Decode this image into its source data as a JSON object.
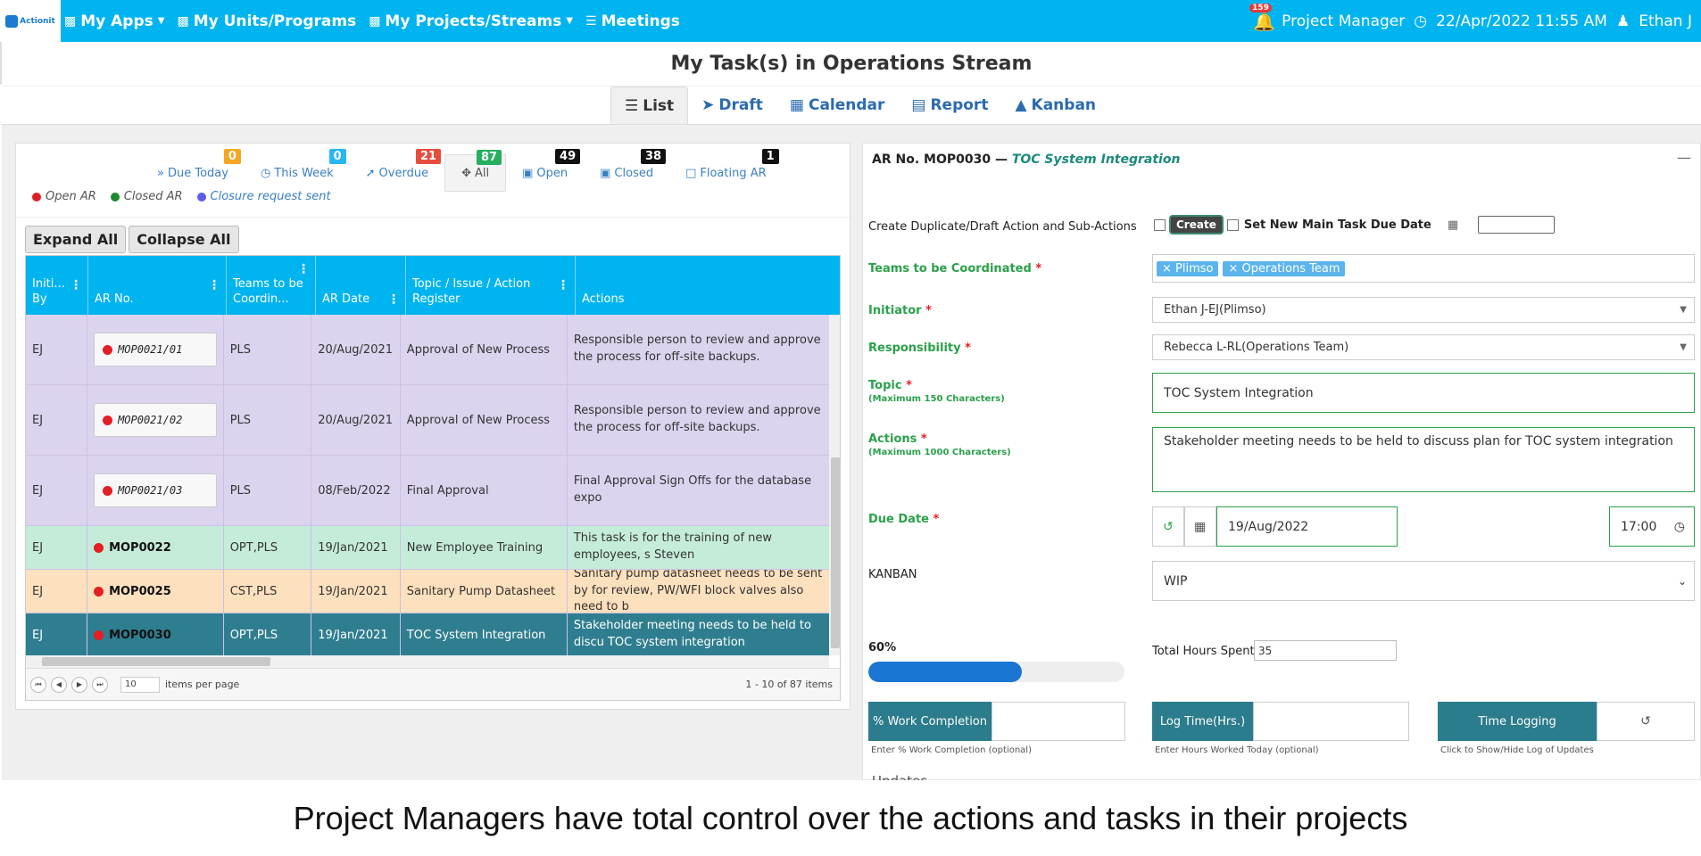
{
  "nav": {
    "logo_text": "Actionit",
    "items": [
      {
        "label": "My Apps",
        "icon": "briefcase-icon",
        "dropdown": true
      },
      {
        "label": "My Units/Programs",
        "icon": "briefcase-icon",
        "dropdown": false
      },
      {
        "label": "My Projects/Streams",
        "icon": "briefcase-icon",
        "dropdown": true
      },
      {
        "label": "Meetings",
        "icon": "list-icon",
        "dropdown": false
      }
    ],
    "notification_count": "159",
    "role": "Project Manager",
    "datetime": "22/Apr/2022 11:55 AM",
    "user": "Ethan J"
  },
  "page_title": "My Task(s) in Operations Stream",
  "view_tabs": [
    {
      "label": "List",
      "icon": "list-icon",
      "active": true
    },
    {
      "label": "Draft",
      "icon": "paper-plane-icon",
      "active": false
    },
    {
      "label": "Calendar",
      "icon": "calendar-icon",
      "active": false
    },
    {
      "label": "Report",
      "icon": "book-icon",
      "active": false
    },
    {
      "label": "Kanban",
      "icon": "area-chart-icon",
      "active": false
    }
  ],
  "filters": [
    {
      "label": "Due Today",
      "icon": "chevrons-down-icon",
      "count": "0",
      "color": "#f5a623"
    },
    {
      "label": "This Week",
      "icon": "clock-icon",
      "count": "0",
      "color": "#29b6f6"
    },
    {
      "label": "Overdue",
      "icon": "arrow-circle-icon",
      "count": "21",
      "color": "#e74c3c"
    },
    {
      "label": "All",
      "icon": "move-icon",
      "count": "87",
      "color": "#27ae60",
      "active": true
    },
    {
      "label": "Open",
      "icon": "unlock-icon",
      "count": "49",
      "color": "#111111"
    },
    {
      "label": "Closed",
      "icon": "lock-icon",
      "count": "38",
      "color": "#111111"
    },
    {
      "label": "Floating AR",
      "icon": "file-icon",
      "count": "1",
      "color": "#111111"
    }
  ],
  "legend": [
    {
      "label": "Open AR",
      "color": "#e31e24"
    },
    {
      "label": "Closed AR",
      "color": "#1e8a2e"
    },
    {
      "label": "Closure request sent",
      "color": "#5b5bf0",
      "link": true
    }
  ],
  "buttons": {
    "expand_all": "Expand All",
    "collapse_all": "Collapse All"
  },
  "grid": {
    "columns": [
      "Initi... By",
      "AR No.",
      "Teams to be Coordin...",
      "AR Date",
      "Topic / Issue / Action Register",
      "Actions"
    ],
    "rows": [
      {
        "initiated_by": "EJ",
        "ar_no": "MOP0021/01",
        "teams": "PLS",
        "ar_date": "20/Aug/2021",
        "topic": "Approval of New Process",
        "actions": "Responsible person to review and approve the process for off-site backups.",
        "bg": "#dcd3ee",
        "boxed": true
      },
      {
        "initiated_by": "EJ",
        "ar_no": "MOP0021/02",
        "teams": "PLS",
        "ar_date": "20/Aug/2021",
        "topic": "Approval of New Process",
        "actions": "Responsible person to review and approve the process for off-site backups.",
        "bg": "#dcd3ee",
        "boxed": true
      },
      {
        "initiated_by": "EJ",
        "ar_no": "MOP0021/03",
        "teams": "PLS",
        "ar_date": "08/Feb/2022",
        "topic": "Final Approval",
        "actions": "Final Approval Sign Offs for the database expo",
        "bg": "#dcd3ee",
        "boxed": true
      },
      {
        "initiated_by": "EJ",
        "ar_no": "MOP0022",
        "teams": "OPT,PLS",
        "ar_date": "19/Jan/2021",
        "topic": "New Employee Training",
        "actions": "This task is for the training of new employees, s Steven",
        "bg": "#c5ecd9",
        "boxed": false
      },
      {
        "initiated_by": "EJ",
        "ar_no": "MOP0025",
        "teams": "CST,PLS",
        "ar_date": "19/Jan/2021",
        "topic": "Sanitary Pump Datasheet",
        "actions": "Sanitary pump datasheet needs to be sent by for review, PW/WFI block valves also need to b",
        "bg": "#fde0bd",
        "boxed": false
      },
      {
        "initiated_by": "EJ",
        "ar_no": "MOP0030",
        "teams": "OPT,PLS",
        "ar_date": "19/Jan/2021",
        "topic": "TOC System Integration",
        "actions": "Stakeholder meeting needs to be held to discu TOC system integration",
        "bg": "#2f7e90",
        "boxed": false,
        "selected": true
      }
    ],
    "page_size": "10",
    "items_per_page_label": "items per page",
    "range_info": "1 - 10 of 87 items"
  },
  "detail": {
    "ar_label": "AR No. MOP0030 —",
    "ar_topic": "TOC System Integration",
    "duplicate_label": "Create Duplicate/Draft Action and Sub-Actions",
    "create_button": "Create",
    "new_due_label": "Set New Main Task Due Date",
    "teams_label": "Teams to be Coordinated",
    "teams": [
      "Plimso",
      "Operations Team"
    ],
    "initiator_label": "Initiator",
    "initiator_value": "Ethan J-EJ(Plimso)",
    "responsibility_label": "Responsibility",
    "responsibility_value": "Rebecca L-RL(Operations Team)",
    "topic_label": "Topic",
    "topic_hint": "(Maximum 150 Characters)",
    "topic_value": "TOC System Integration",
    "actions_label": "Actions",
    "actions_hint": "(Maximum 1000 Characters)",
    "actions_value": "Stakeholder meeting needs to be held to discuss plan for TOC system integration",
    "due_label": "Due Date",
    "due_date": "19/Aug/2022",
    "due_time": "17:00",
    "kanban_label": "KANBAN",
    "kanban_value": "WIP",
    "progress_label": "60%",
    "progress_fraction": 0.6,
    "hours_label": "Total Hours Spent:",
    "hours_value": "35",
    "work_completion_btn": "% Work Completion",
    "work_completion_hint": "Enter % Work Completion (optional)",
    "log_time_btn": "Log Time(Hrs.)",
    "log_time_hint": "Enter Hours Worked Today (optional)",
    "time_logging_btn": "Time Logging",
    "time_logging_hint": "Click to Show/Hide Log of Updates",
    "updates_label": "Updates"
  },
  "caption": "Project Managers have total control over the actions and tasks in their projects"
}
